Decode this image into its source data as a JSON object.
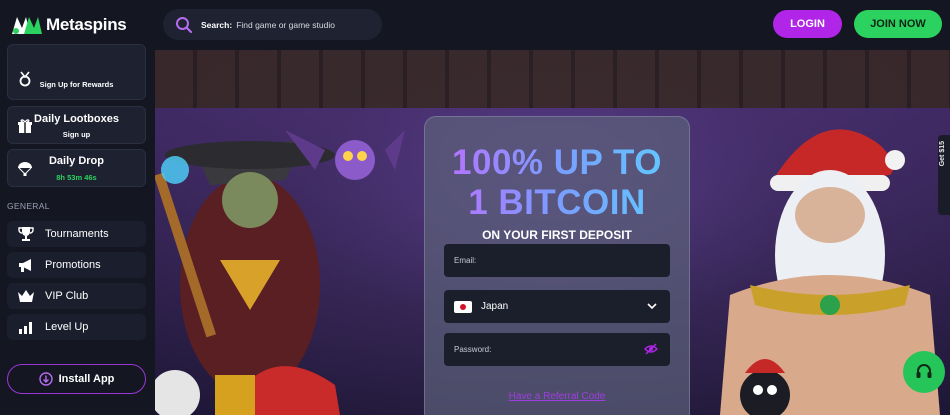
{
  "brand": {
    "name": "Metaspins"
  },
  "header": {
    "search_label": "Search:",
    "search_placeholder": "Find game or game studio",
    "login_label": "LOGIN",
    "join_label": "JOIN NOW"
  },
  "sidebar": {
    "rewards": {
      "subtitle": "Sign Up for Rewards"
    },
    "lootboxes": {
      "title": "Daily Lootboxes",
      "subtitle": "Sign up"
    },
    "daily_drop": {
      "title": "Daily Drop",
      "countdown": "8h 53m 46s"
    },
    "section_general": "GENERAL",
    "nav": [
      {
        "label": "Tournaments",
        "icon": "trophy-icon"
      },
      {
        "label": "Promotions",
        "icon": "megaphone-icon"
      },
      {
        "label": "VIP Club",
        "icon": "crown-icon"
      },
      {
        "label": "Level Up",
        "icon": "bar-chart-icon"
      }
    ],
    "install_label": "Install App"
  },
  "hero": {
    "headline_line1": "100% UP TO",
    "headline_line2": "1 BITCOIN",
    "subheadline": "ON YOUR FIRST DEPOSIT",
    "email_placeholder": "Email:",
    "country_value": "Japan",
    "password_placeholder": "Password:",
    "referral_link": "Have a Referral Code"
  },
  "side_tab_label": "Get $15",
  "colors": {
    "accent_purple": "#b025e8",
    "accent_green": "#2bd25f",
    "background": "#10121c"
  }
}
